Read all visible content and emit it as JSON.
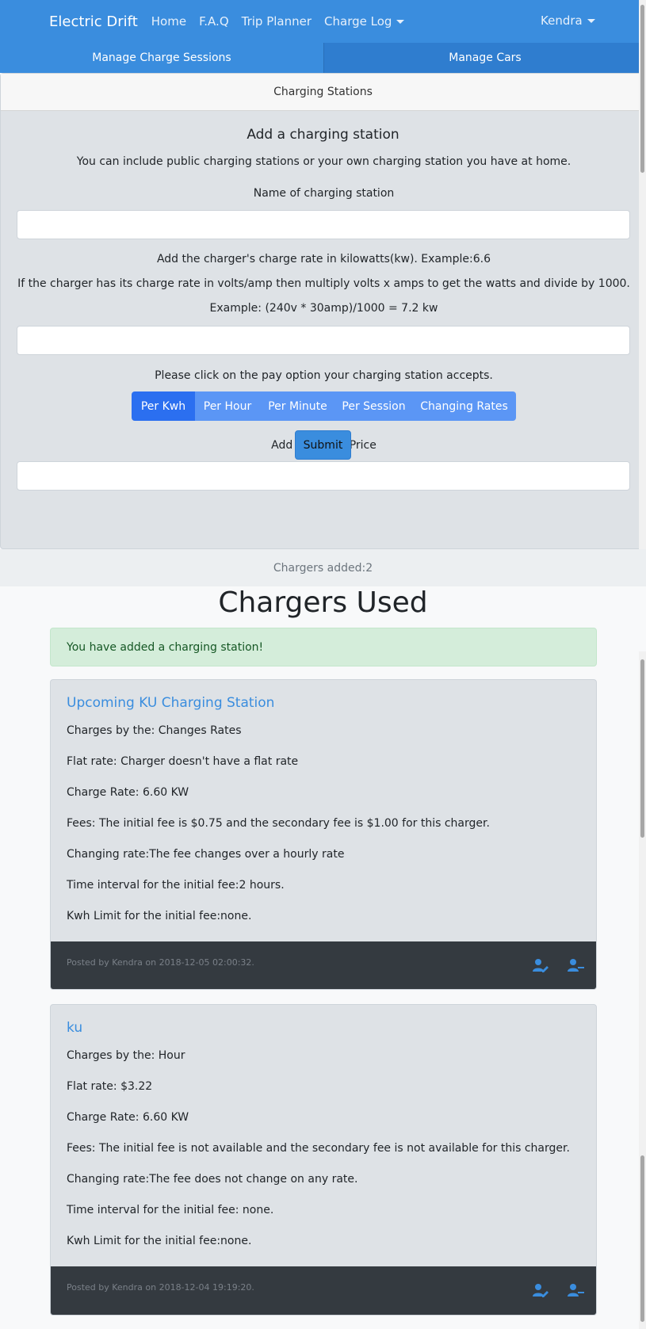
{
  "navbar": {
    "brand": "Electric Drift",
    "links": [
      "Home",
      "F.A.Q",
      "Trip Planner",
      "Charge Log"
    ],
    "user": "Kendra"
  },
  "tabs": [
    "Manage Charge Sessions",
    "Manage Cars"
  ],
  "form": {
    "header": "Charging Stations",
    "title": "Add a charging station",
    "intro": "You can include public charging stations or your own charging station you have at home.",
    "name_label": "Name of charging station",
    "rate_label": "Add the charger's charge rate in kilowatts(kw). Example:6.6",
    "rate_help": "If the charger has its charge rate in volts/amp then multiply volts x amps to get the watts and divide by 1000.",
    "rate_example": "Example: (240v * 30amp)/1000 = 7.2 kw",
    "pay_label": "Please click on the pay option your charging station accepts.",
    "pay_options": [
      "Per Kwh",
      "Per Hour",
      "Per Minute",
      "Per Session",
      "Changing Rates"
    ],
    "flat_label": "Add Flat Rate Price",
    "submit": "Submit"
  },
  "chargers_added": "Chargers added:2",
  "page_title": "Chargers Used",
  "alert": "You have added a charging station!",
  "chargers": [
    {
      "name": "Upcoming KU Charging Station",
      "charges_by": "Charges by the: Changes Rates",
      "flat_rate": "Flat rate: Charger doesn't have a flat rate",
      "charge_rate": "Charge Rate: 6.60 KW",
      "fees": "Fees: The initial fee is $0.75 and the secondary fee is $1.00 for this charger.",
      "changing_rate": "Changing rate:The fee changes over a hourly rate",
      "time_interval": "Time interval for the initial fee:2 hours.",
      "kwh_limit": "Kwh Limit for the initial fee:none.",
      "posted": "Posted by Kendra on 2018-12-05 02:00:32."
    },
    {
      "name": "ku",
      "charges_by": "Charges by the: Hour",
      "flat_rate": "Flat rate: $3.22",
      "charge_rate": "Charge Rate: 6.60 KW",
      "fees": "Fees: The initial fee is not available and the secondary fee is not available for this charger.",
      "changing_rate": "Changing rate:The fee does not change on any rate.",
      "time_interval": "Time interval for the initial fee: none.",
      "kwh_limit": "Kwh Limit for the initial fee:none.",
      "posted": "Posted by Kendra on 2018-12-04 19:19:20."
    }
  ],
  "icons": {
    "edit": "user-edit-icon",
    "remove": "user-minus-icon"
  },
  "colors": {
    "primary": "#3a8dde",
    "active_pay": "#2b6ff0",
    "pay": "#5b96f5",
    "footer": "#343a40"
  }
}
